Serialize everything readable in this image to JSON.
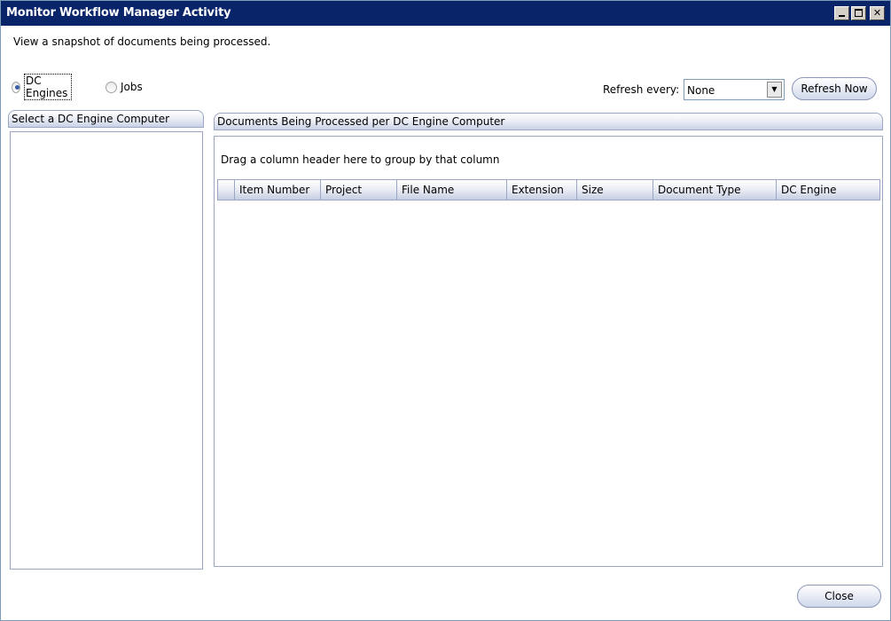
{
  "window": {
    "title": "Monitor Workflow Manager Activity",
    "description": "View a snapshot of documents being processed."
  },
  "view_options": {
    "items": [
      {
        "label": "DC Engines",
        "checked": true
      },
      {
        "label": "Jobs",
        "checked": false
      }
    ]
  },
  "refresh": {
    "label": "Refresh every:",
    "selected": "None",
    "button": "Refresh Now"
  },
  "left_panel": {
    "title": "Select a DC Engine Computer"
  },
  "right_panel": {
    "title": "Documents Being Processed per DC Engine Computer",
    "group_hint": "Drag a column header here to group by that column",
    "columns": [
      "Item Number",
      "Project",
      "File Name",
      "Extension",
      "Size",
      "Document Type",
      "DC Engine"
    ]
  },
  "footer": {
    "close": "Close"
  }
}
